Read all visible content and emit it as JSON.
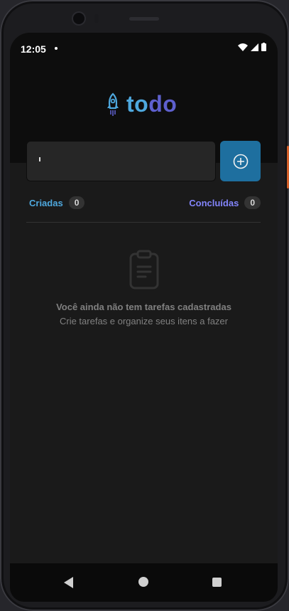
{
  "status": {
    "time": "12:05"
  },
  "logo": {
    "part1": "to",
    "part2": "do"
  },
  "input": {
    "value": "",
    "placeholder": ""
  },
  "counters": {
    "created": {
      "label": "Criadas",
      "count": "0"
    },
    "done": {
      "label": "Concluídas",
      "count": "0"
    }
  },
  "empty": {
    "title": "Você ainda não tem tarefas cadastradas",
    "subtitle": "Crie tarefas e organize seus itens a fazer"
  },
  "colors": {
    "accent_blue": "#4ea8de",
    "accent_purple": "#8284fa",
    "button": "#1e6f9f"
  },
  "icons": {
    "add": "plus-circle-icon",
    "empty": "clipboard-icon",
    "logo": "rocket-icon"
  }
}
